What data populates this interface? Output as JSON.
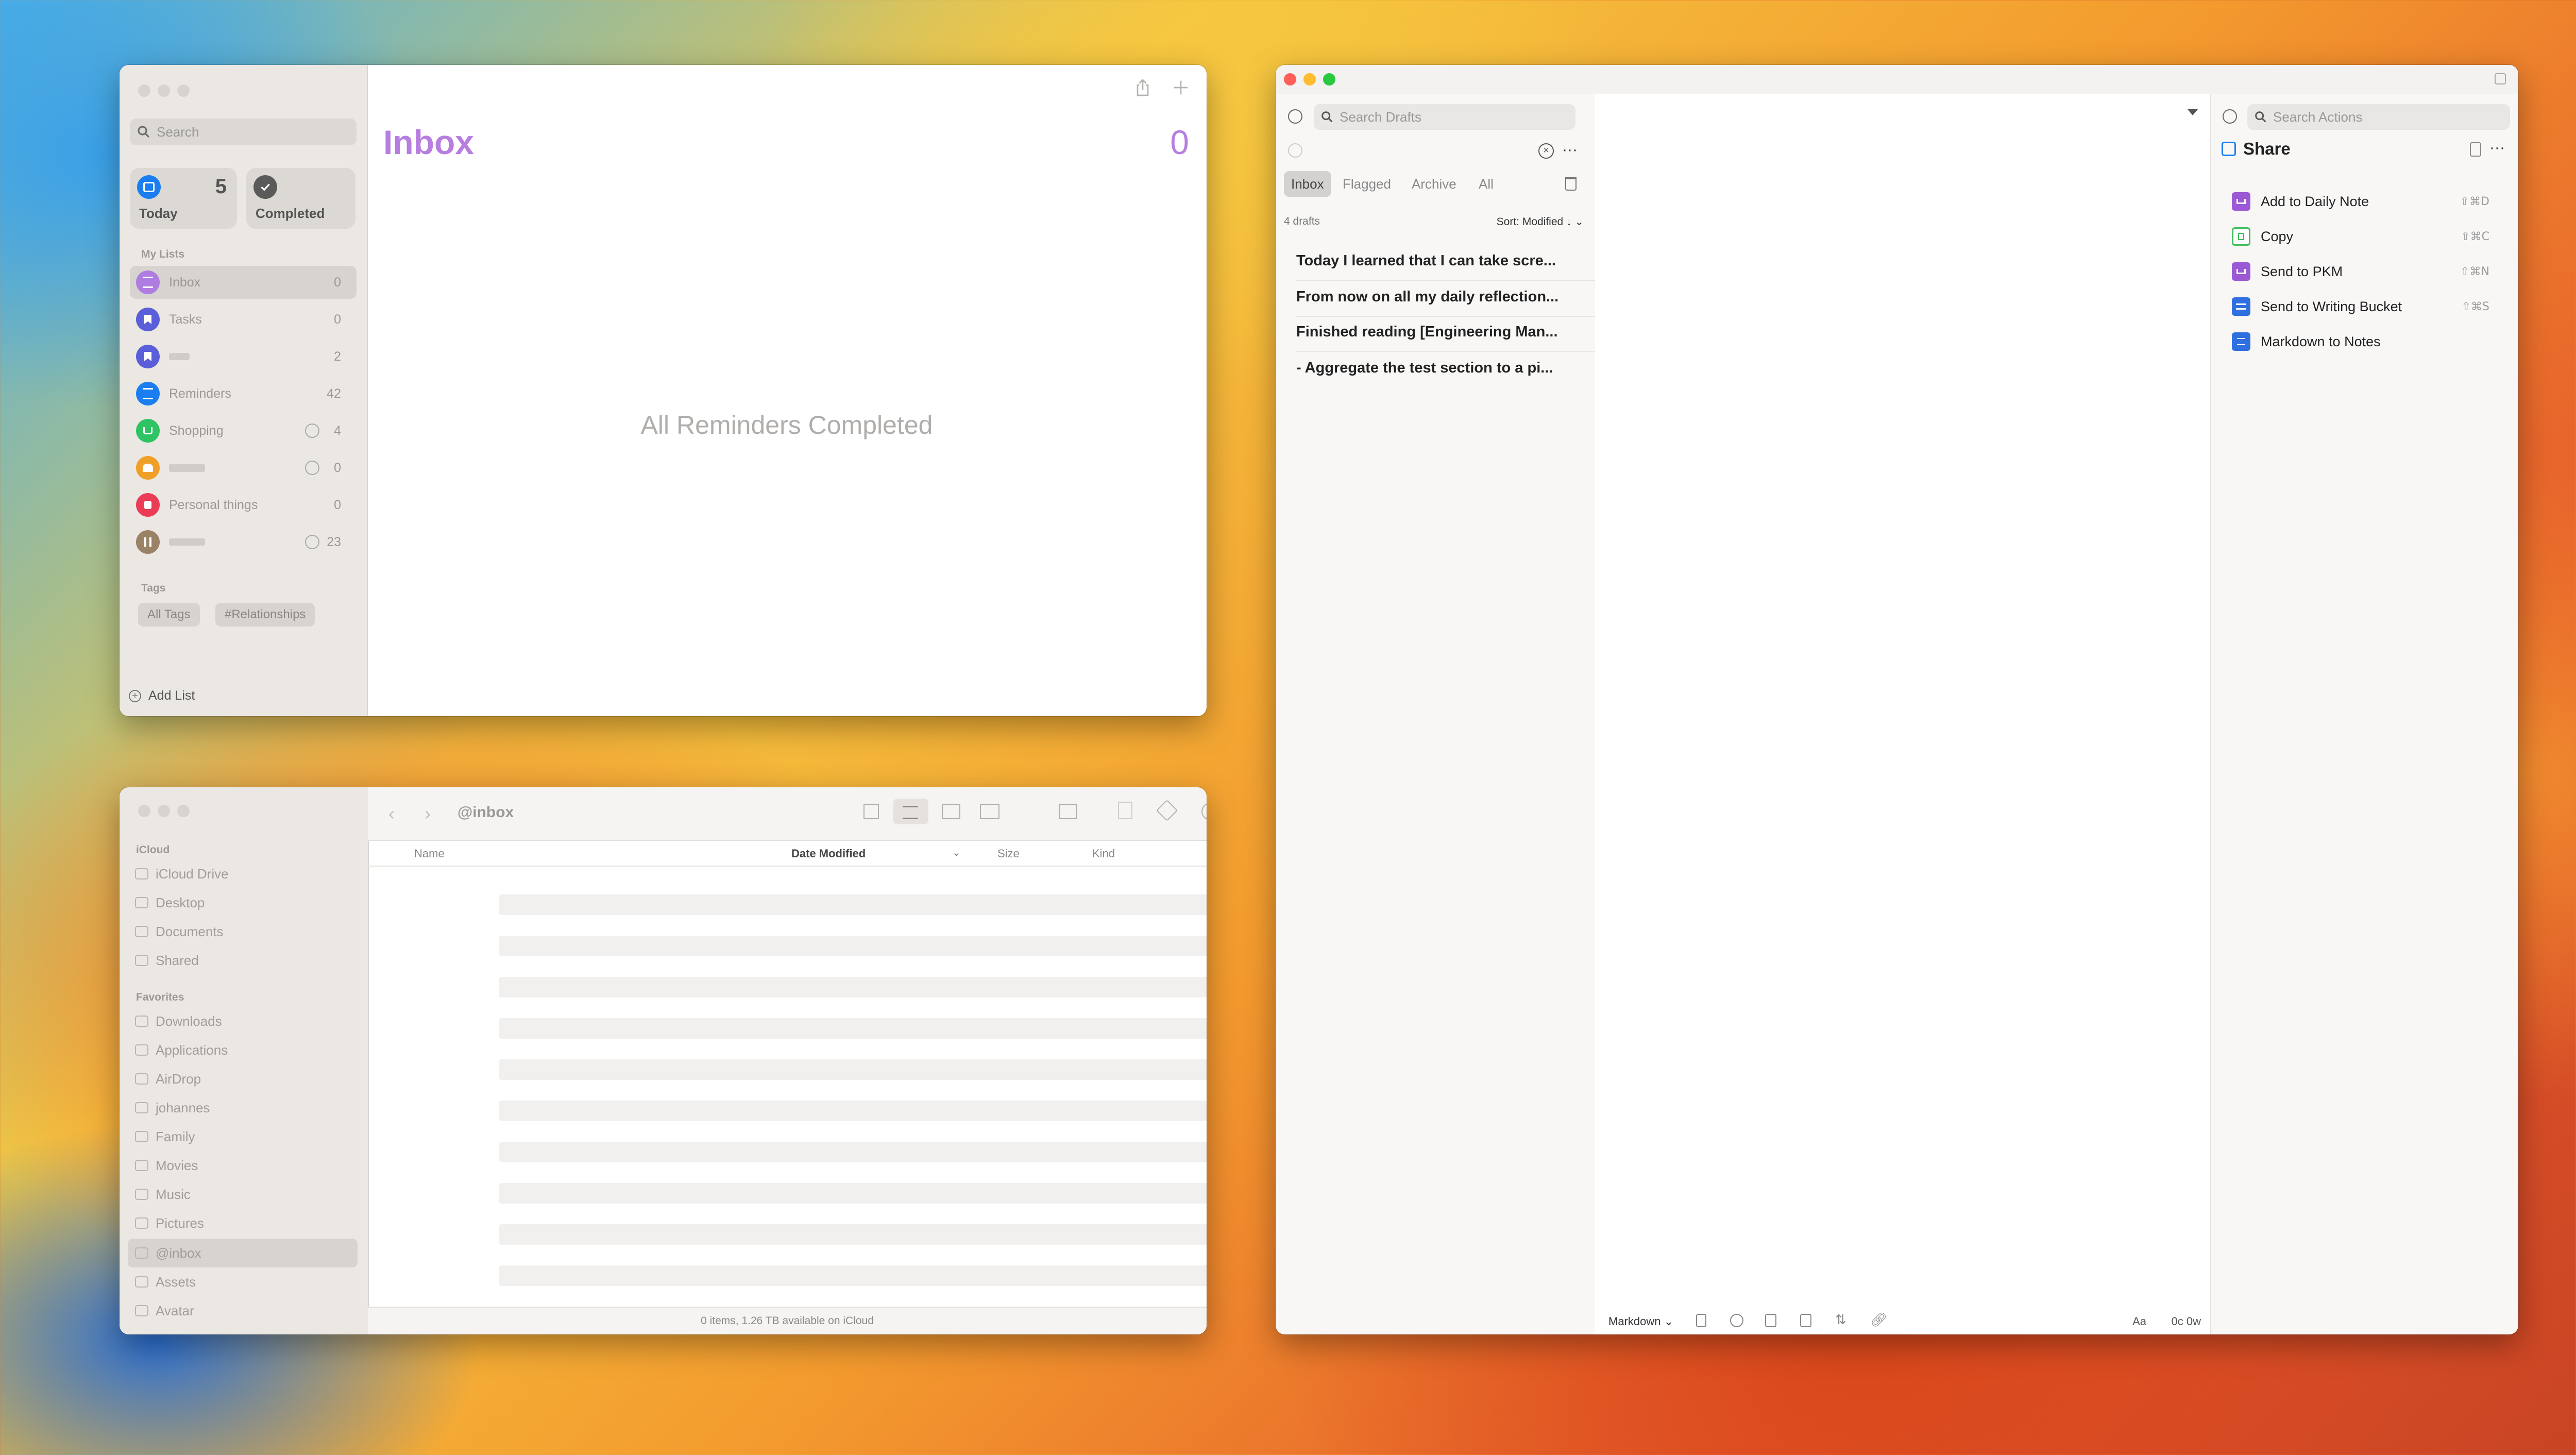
{
  "reminders": {
    "search_placeholder": "Search",
    "today": {
      "label": "Today",
      "count": "5"
    },
    "completed": {
      "label": "Completed"
    },
    "my_lists_header": "My Lists",
    "lists": [
      {
        "name": "Inbox",
        "count": "0",
        "color": "#af7ce0",
        "shared": false
      },
      {
        "name": "Tasks",
        "count": "0",
        "color": "#5b5ed9",
        "shared": false
      },
      {
        "name": "",
        "count": "2",
        "color": "#5b5ed9",
        "shared": false
      },
      {
        "name": "Reminders",
        "count": "42",
        "color": "#1a7ef0",
        "shared": false
      },
      {
        "name": "Shopping",
        "count": "4",
        "color": "#2fc463",
        "shared": true
      },
      {
        "name": "",
        "count": "0",
        "color": "#f0a028",
        "shared": true
      },
      {
        "name": "Personal things",
        "count": "0",
        "color": "#ea3c56",
        "shared": false
      },
      {
        "name": "",
        "count": "23",
        "color": "#9a8266",
        "shared": true
      }
    ],
    "tags_header": "Tags",
    "tags": [
      "All Tags",
      "#Relationships"
    ],
    "add_list": "Add List",
    "main_title": "Inbox",
    "main_count": "0",
    "empty_message": "All Reminders Completed",
    "accent": "#b77ee0"
  },
  "finder": {
    "title": "@inbox",
    "icloud_header": "iCloud",
    "icloud_items": [
      "iCloud Drive",
      "Desktop",
      "Documents",
      "Shared"
    ],
    "favorites_header": "Favorites",
    "favorite_items": [
      "Downloads",
      "Applications",
      "AirDrop",
      "johannes",
      "Family",
      "Movies",
      "Music",
      "Pictures",
      "@inbox",
      "Assets",
      "Avatar"
    ],
    "columns": {
      "name": "Name",
      "date": "Date Modified",
      "size": "Size",
      "kind": "Kind"
    },
    "status": "0 items, 1.26 TB available on iCloud"
  },
  "drafts": {
    "search_placeholder": "Search Drafts",
    "tabs": [
      "Inbox",
      "Flagged",
      "Archive",
      "All"
    ],
    "count_label": "4 drafts",
    "sort_label": "Sort: Modified ↓",
    "items": [
      "Today I learned that I can take scre...",
      "From now on all my daily reflection...",
      "Finished reading [Engineering Man...",
      "- Aggregate the test section to a pi..."
    ],
    "actions_search_placeholder": "Search Actions",
    "actions_group": "Share",
    "actions": [
      {
        "label": "Add to Daily Note",
        "shortcut": "⇧⌘D",
        "color": "#9b59d6"
      },
      {
        "label": "Copy",
        "shortcut": "⇧⌘C",
        "color": "#3fbf5b"
      },
      {
        "label": "Send to PKM",
        "shortcut": "⇧⌘N",
        "color": "#9b59d6"
      },
      {
        "label": "Send to Writing Bucket",
        "shortcut": "⇧⌘S",
        "color": "#2f6fe0"
      },
      {
        "label": "Markdown to Notes",
        "shortcut": "",
        "color": "#2f6fe0"
      }
    ],
    "syntax_label": "Markdown",
    "font_label": "Aa",
    "word_count": "0c 0w",
    "accent": "#1a7ef0"
  }
}
